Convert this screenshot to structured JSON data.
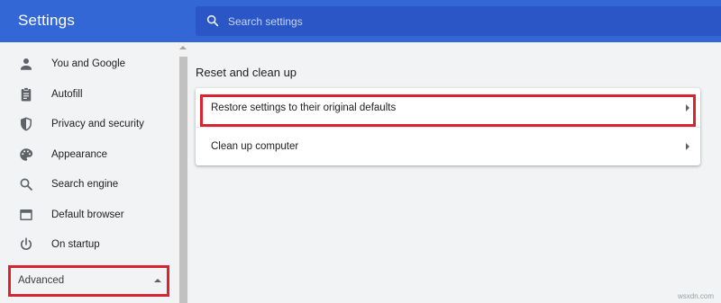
{
  "header": {
    "title": "Settings",
    "search": {
      "placeholder": "Search settings",
      "value": ""
    }
  },
  "sidebar": {
    "items": [
      {
        "label": "You and Google",
        "icon": "person-icon"
      },
      {
        "label": "Autofill",
        "icon": "clipboard-icon"
      },
      {
        "label": "Privacy and security",
        "icon": "shield-icon"
      },
      {
        "label": "Appearance",
        "icon": "palette-icon"
      },
      {
        "label": "Search engine",
        "icon": "search-icon"
      },
      {
        "label": "Default browser",
        "icon": "browser-window-icon"
      },
      {
        "label": "On startup",
        "icon": "power-icon"
      }
    ],
    "advanced": {
      "label": "Advanced",
      "expanded": true
    }
  },
  "main": {
    "section_title": "Reset and clean up",
    "rows": [
      {
        "label": "Restore settings to their original defaults"
      },
      {
        "label": "Clean up computer"
      }
    ]
  },
  "watermark": "wsxdn.com",
  "colors": {
    "header": "#3367d6",
    "search_box": "#2a56c6",
    "background": "#f1f3f4",
    "highlight": "#d9232e",
    "icon": "#5f6368"
  }
}
